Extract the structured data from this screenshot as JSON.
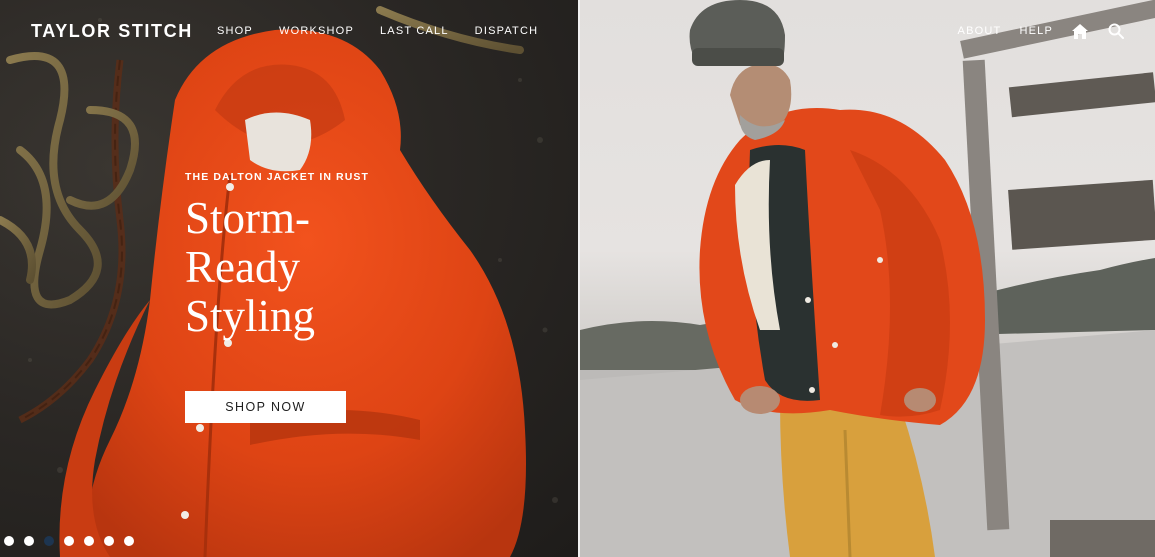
{
  "brand": {
    "logo_text": "TAYLOR STITCH"
  },
  "nav": {
    "left_links": [
      {
        "label": "SHOP"
      },
      {
        "label": "WORKSHOP"
      },
      {
        "label": "LAST CALL"
      },
      {
        "label": "DISPATCH"
      }
    ],
    "right_links": [
      {
        "label": "ABOUT"
      },
      {
        "label": "HELP"
      }
    ],
    "icons": [
      "home-icon",
      "search-icon"
    ]
  },
  "hero": {
    "eyebrow": "THE DALTON JACKET IN RUST",
    "headline_lines": [
      "Storm-",
      "Ready",
      "Styling"
    ],
    "cta_label": "SHOP NOW"
  },
  "carousel": {
    "slide_count": 7,
    "active_index": 2
  },
  "colors": {
    "accent_rust": "#e2481a",
    "active_dot": "#1d3550",
    "text_light": "#ffffff"
  }
}
